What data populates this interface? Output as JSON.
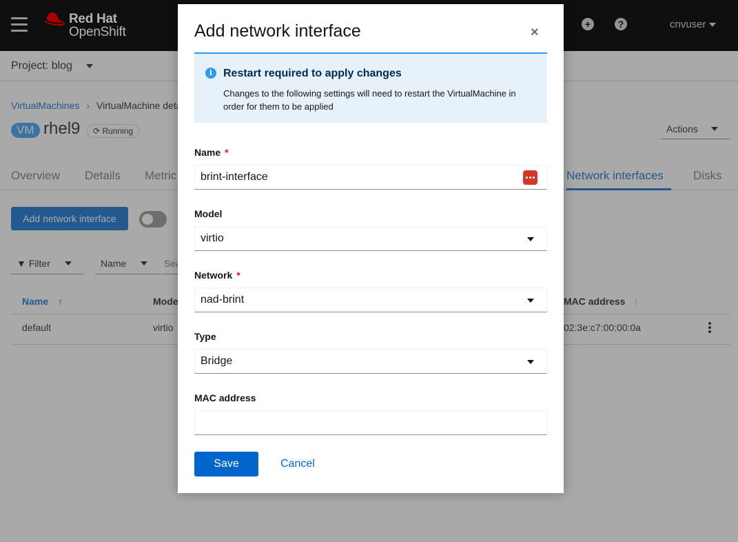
{
  "masthead": {
    "brand": "Red Hat",
    "product": "OpenShift",
    "user": "cnvuser",
    "icons": [
      "menu-icon",
      "plus-circle-icon",
      "help-icon"
    ]
  },
  "project": {
    "label": "Project: blog"
  },
  "breadcrumb": {
    "root": "VirtualMachines",
    "current": "VirtualMachine deta"
  },
  "vm": {
    "badge": "VM",
    "name": "rhel9",
    "status": "Running"
  },
  "actions_label": "Actions",
  "tabs": {
    "overview": "Overview",
    "details": "Details",
    "metrics": "Metric",
    "network": "Network interfaces",
    "disks": "Disks"
  },
  "toolbar": {
    "add_button": "Add network interface",
    "filter": "Filter",
    "name_filter": "Name",
    "search_placeholder": "Sea"
  },
  "table": {
    "headers": {
      "name": "Name",
      "model": "Mode",
      "mac": "MAC address"
    },
    "rows": [
      {
        "name": "default",
        "model": "virtio",
        "mac": "02:3e:c7:00:00:0a"
      }
    ]
  },
  "modal": {
    "title": "Add network interface",
    "close": "×",
    "alert": {
      "title": "Restart required to apply changes",
      "body": "Changes to the following settings will need to restart the VirtualMachine in order for them to be applied"
    },
    "fields": {
      "name": {
        "label": "Name",
        "required": "*",
        "value": "brint-interface"
      },
      "model": {
        "label": "Model",
        "value": "virtio"
      },
      "network": {
        "label": "Network",
        "required": "*",
        "value": "nad-brint"
      },
      "type": {
        "label": "Type",
        "value": "Bridge"
      },
      "mac": {
        "label": "MAC address",
        "value": ""
      }
    },
    "save": "Save",
    "cancel": "Cancel"
  },
  "colors": {
    "accent": "#0066cc",
    "info": "#2b9af3",
    "required": "#c9190b",
    "masthead": "#151515"
  }
}
